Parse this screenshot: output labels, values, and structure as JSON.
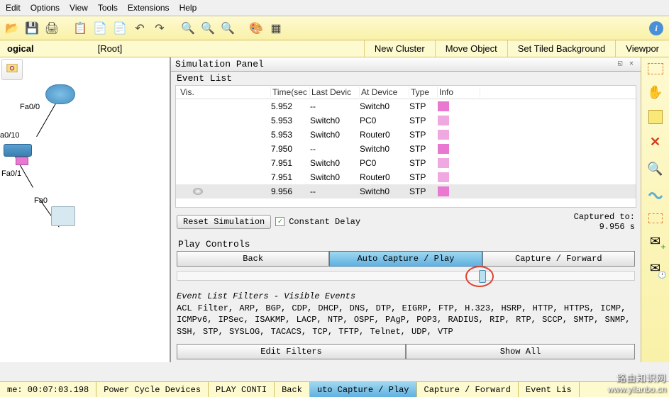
{
  "menu": {
    "items": [
      "Edit",
      "Options",
      "View",
      "Tools",
      "Extensions",
      "Help"
    ]
  },
  "subbar": {
    "logical": "ogical",
    "root": "[Root]",
    "newCluster": "New Cluster",
    "moveObject": "Move Object",
    "setTiled": "Set Tiled Background",
    "viewport": "Viewpor"
  },
  "canvas": {
    "labels": {
      "fa00": "Fa0/0",
      "fa010": "a0/10",
      "fa01": "Fa0/1",
      "fa0": "Fa0"
    }
  },
  "sim": {
    "title": "Simulation Panel",
    "eventList": "Event List",
    "columns": {
      "vis": "Vis.",
      "time": "Time(sec",
      "last": "Last Devic",
      "at": "At Device",
      "type": "Type",
      "info": "Info"
    },
    "rows": [
      {
        "time": "5.952",
        "last": "--",
        "at": "Switch0",
        "type": "STP",
        "light": false
      },
      {
        "time": "5.953",
        "last": "Switch0",
        "at": "PC0",
        "type": "STP",
        "light": true
      },
      {
        "time": "5.953",
        "last": "Switch0",
        "at": "Router0",
        "type": "STP",
        "light": true
      },
      {
        "time": "7.950",
        "last": "--",
        "at": "Switch0",
        "type": "STP",
        "light": false
      },
      {
        "time": "7.951",
        "last": "Switch0",
        "at": "PC0",
        "type": "STP",
        "light": true
      },
      {
        "time": "7.951",
        "last": "Switch0",
        "at": "Router0",
        "type": "STP",
        "light": true
      },
      {
        "time": "9.956",
        "last": "--",
        "at": "Switch0",
        "type": "STP",
        "light": false,
        "sel": true
      }
    ],
    "reset": "Reset Simulation",
    "constDelay": "Constant Delay",
    "capturedTo": "Captured to:",
    "capturedVal": "9.956 s",
    "playControls": "Play Controls",
    "back": "Back",
    "auto": "Auto Capture / Play",
    "forward": "Capture / Forward",
    "filterTitle": "Event List Filters - Visible Events",
    "filterList": "ACL Filter, ARP, BGP, CDP, DHCP, DNS, DTP, EIGRP, FTP, H.323, HSRP, HTTP, HTTPS, ICMP, ICMPv6, IPSec, ISAKMP, LACP, NTP, OSPF, PAgP, POP3, RADIUS, RIP, RTP, SCCP, SMTP, SNMP, SSH, STP, SYSLOG, TACACS, TCP, TFTP, Telnet, UDP, VTP",
    "editFilters": "Edit Filters",
    "showAll": "Show All"
  },
  "status": {
    "time": "me: 00:07:03.198",
    "power": "Power Cycle Devices",
    "playCtrl": "PLAY CONTI",
    "back": "Back",
    "auto": "uto Capture / Play",
    "fwd": "Capture / Forward",
    "evlist": "Event Lis"
  },
  "watermark": {
    "line1": "路由知识网",
    "line2": "www.yilanbo.cn"
  },
  "icons": {
    "open": "open-folder-icon",
    "save": "save-icon",
    "print": "print-icon",
    "copy": "copy-icon",
    "paste": "paste-icon",
    "undo": "undo-icon",
    "redo": "redo-icon",
    "zoomin": "zoom-in-icon",
    "zoomreset": "zoom-reset-icon",
    "zoomout": "zoom-out-icon",
    "palette": "palette-icon",
    "custom": "device-icon",
    "select": "select-marquee-icon",
    "hand": "hand-icon",
    "note": "note-icon",
    "delete": "delete-x-icon",
    "inspect": "magnify-icon",
    "shape": "shape-icon",
    "resize": "resize-icon",
    "env1": "envelope-plus-icon",
    "env2": "envelope-clock-icon"
  }
}
